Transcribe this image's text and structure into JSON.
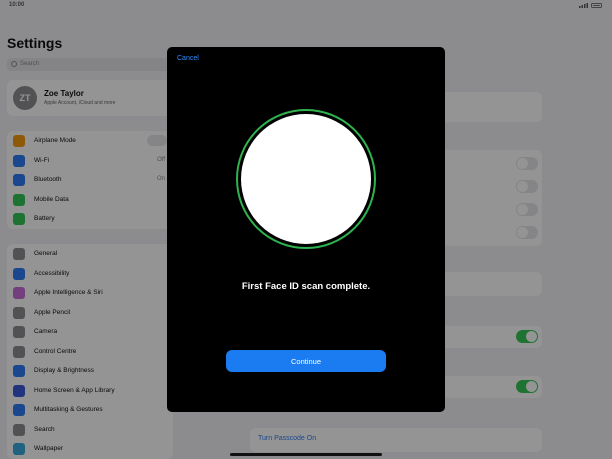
{
  "status_bar": {
    "time": "10:00"
  },
  "sidebar": {
    "title": "Settings",
    "search_placeholder": "Search",
    "profile": {
      "initials": "ZT",
      "name": "Zoe Taylor",
      "subtitle": "Apple Account, iCloud and more"
    },
    "group1": [
      {
        "label": "Airplane Mode",
        "value": "",
        "icon_color": "#f39c12"
      },
      {
        "label": "Wi-Fi",
        "value": "Off",
        "icon_color": "#2f7bf5"
      },
      {
        "label": "Bluetooth",
        "value": "On",
        "icon_color": "#2f7bf5"
      },
      {
        "label": "Mobile Data",
        "value": "",
        "icon_color": "#34c759"
      },
      {
        "label": "Battery",
        "value": "",
        "icon_color": "#34c759"
      }
    ],
    "group2": [
      {
        "label": "General",
        "icon_color": "#8e8e93"
      },
      {
        "label": "Accessibility",
        "icon_color": "#2f7bf5"
      },
      {
        "label": "Apple Intelligence & Siri",
        "icon_color": "#c86dd7"
      },
      {
        "label": "Apple Pencil",
        "icon_color": "#8e8e93"
      },
      {
        "label": "Camera",
        "icon_color": "#8e8e93"
      },
      {
        "label": "Control Centre",
        "icon_color": "#8e8e93"
      },
      {
        "label": "Display & Brightness",
        "icon_color": "#2f7bf5"
      },
      {
        "label": "Home Screen & App Library",
        "icon_color": "#3b5bdb"
      },
      {
        "label": "Multitasking & Gestures",
        "icon_color": "#2f7bf5"
      },
      {
        "label": "Search",
        "icon_color": "#8e8e93"
      },
      {
        "label": "Wallpaper",
        "icon_color": "#37aadc"
      }
    ]
  },
  "detail": {
    "turn_passcode_on": "Turn Passcode On"
  },
  "modal": {
    "cancel_label": "Cancel",
    "status_text": "First Face ID scan complete.",
    "continue_label": "Continue"
  },
  "colors": {
    "accent": "#2f8cff",
    "button": "#1b7cf2",
    "scan_ring": "#2fb34e",
    "toggle_on": "#34c759"
  }
}
